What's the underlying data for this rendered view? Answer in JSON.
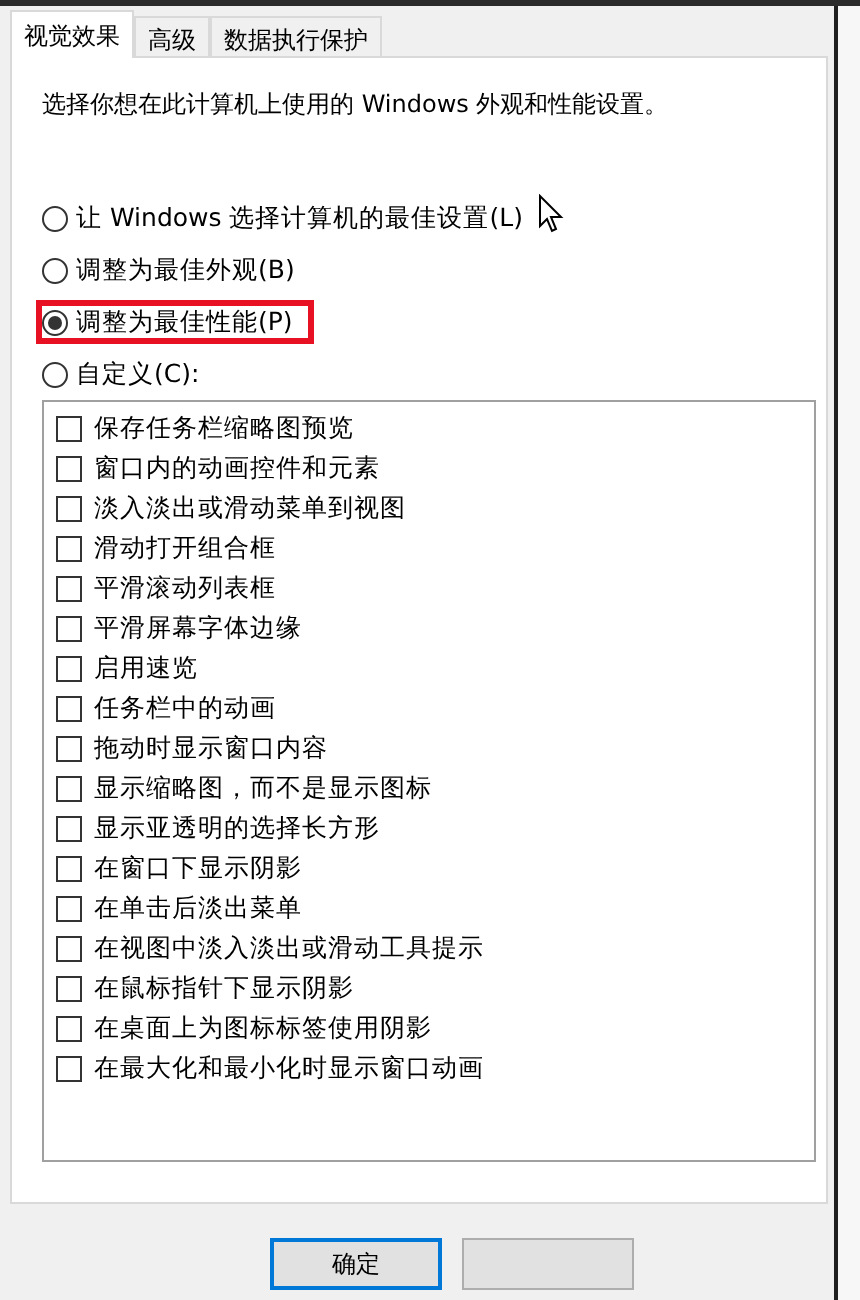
{
  "tabs": [
    {
      "label": "视觉效果",
      "selected": true
    },
    {
      "label": "高级",
      "selected": false
    },
    {
      "label": "数据执行保护",
      "selected": false
    }
  ],
  "description": "选择你想在此计算机上使用的 Windows 外观和性能设置。",
  "options": [
    {
      "label": "让 Windows 选择计算机的最佳设置(L)",
      "selected": false,
      "highlighted": false
    },
    {
      "label": "调整为最佳外观(B)",
      "selected": false,
      "highlighted": false
    },
    {
      "label": "调整为最佳性能(P)",
      "selected": true,
      "highlighted": true
    },
    {
      "label": "自定义(C):",
      "selected": false,
      "highlighted": false
    }
  ],
  "effects": [
    {
      "label": "保存任务栏缩略图预览",
      "checked": false
    },
    {
      "label": "窗口内的动画控件和元素",
      "checked": false
    },
    {
      "label": "淡入淡出或滑动菜单到视图",
      "checked": false
    },
    {
      "label": "滑动打开组合框",
      "checked": false
    },
    {
      "label": "平滑滚动列表框",
      "checked": false
    },
    {
      "label": "平滑屏幕字体边缘",
      "checked": false
    },
    {
      "label": "启用速览",
      "checked": false
    },
    {
      "label": "任务栏中的动画",
      "checked": false
    },
    {
      "label": "拖动时显示窗口内容",
      "checked": false
    },
    {
      "label": "显示缩略图，而不是显示图标",
      "checked": false
    },
    {
      "label": "显示亚透明的选择长方形",
      "checked": false
    },
    {
      "label": "在窗口下显示阴影",
      "checked": false
    },
    {
      "label": "在单击后淡出菜单",
      "checked": false
    },
    {
      "label": "在视图中淡入淡出或滑动工具提示",
      "checked": false
    },
    {
      "label": "在鼠标指针下显示阴影",
      "checked": false
    },
    {
      "label": "在桌面上为图标标签使用阴影",
      "checked": false
    },
    {
      "label": "在最大化和最小化时显示窗口动画",
      "checked": false
    }
  ],
  "buttons": [
    {
      "label": "确定",
      "kind": "default"
    },
    {
      "kind": "plain"
    }
  ]
}
